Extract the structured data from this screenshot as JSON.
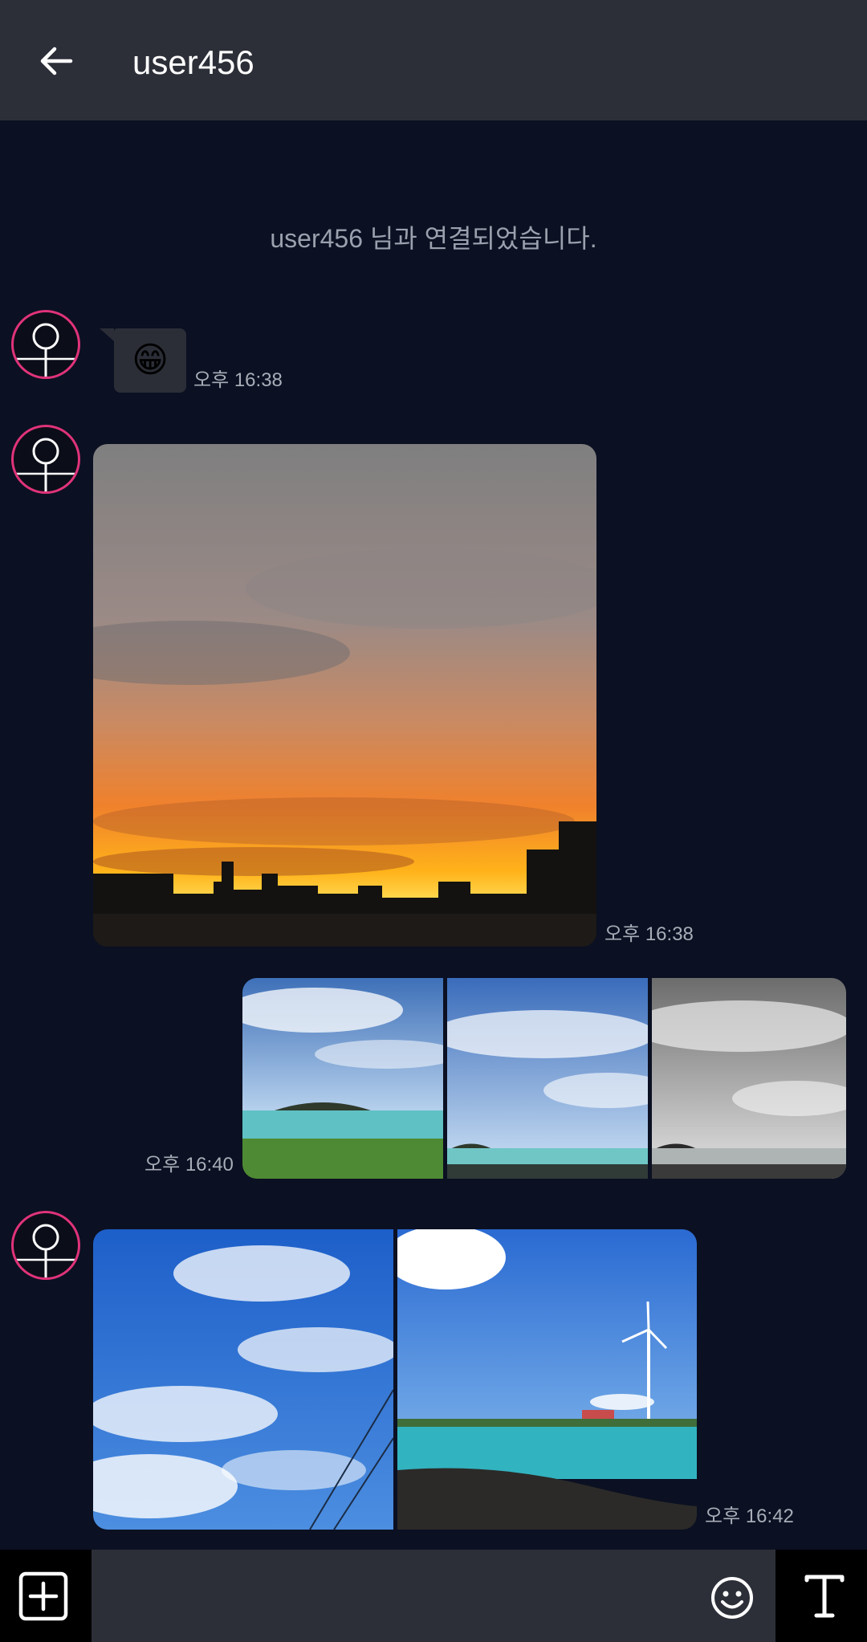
{
  "header": {
    "title": "user456",
    "back_icon": "arrow-left-icon"
  },
  "system_message": "user456 님과 연결되었습니다.",
  "messages": [
    {
      "type": "emoji",
      "side": "left",
      "emoji": "😁",
      "time": "오후 16:38"
    },
    {
      "type": "image",
      "side": "left",
      "subject": "sunset-over-city",
      "time": "오후 16:38"
    },
    {
      "type": "image-group",
      "side": "right",
      "count": 3,
      "time": "오후 16:40"
    },
    {
      "type": "image-group",
      "side": "left",
      "count": 2,
      "time": "오후 16:42"
    }
  ],
  "input_bar": {
    "placeholder": "",
    "add_icon": "plus-square-icon",
    "emoji_icon": "smiley-icon",
    "text_icon": "text-format-icon"
  },
  "colors": {
    "background": "#0b1022",
    "header": "#2c2f38",
    "avatar_ring": "#e0337a",
    "bubble": "#2b2e37"
  }
}
